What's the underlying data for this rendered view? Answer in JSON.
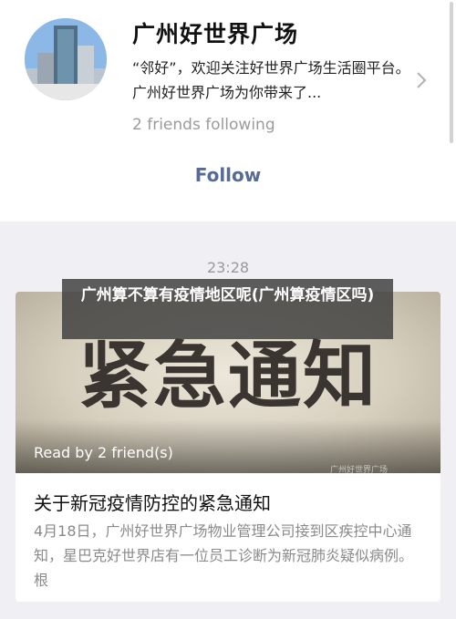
{
  "account": {
    "name": "广州好世界广场",
    "description": "“邻好”，欢迎关注好世界广场生活圈平台。广州好世界广场为你带来了...",
    "friends_following": "2 friends following",
    "follow_label": "Follow"
  },
  "message": {
    "time": "23:28",
    "cover_text": "紧急通知",
    "read_by": "Read by 2 friend(s)",
    "cover_watermark": "广州好世界广场",
    "title": "关于新冠疫情防控的紧急通知",
    "digest": "4月18日，广州好世界广场物业管理公司接到区疾控中心通知，星巴克好世界店有一位员工诊断为新冠肺炎疑似病例。根"
  },
  "overlay": {
    "text": "广州算不算有疫情地区呢(广州算疫情区吗)"
  },
  "icons": {
    "chevron": "chevron-right-icon",
    "avatar": "building-photo"
  },
  "colors": {
    "link": "#576b95",
    "background": "#efeff4"
  }
}
